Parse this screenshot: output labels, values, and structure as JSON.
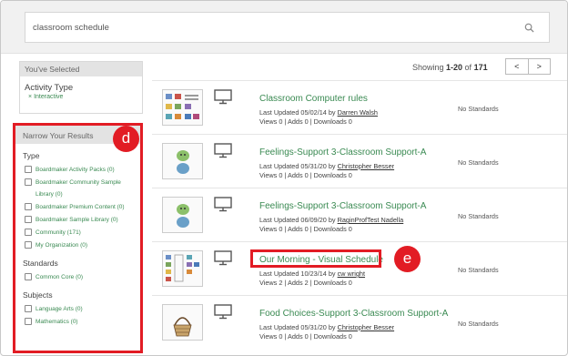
{
  "search": {
    "value": "classroom schedule"
  },
  "selected": {
    "header": "You've Selected",
    "filter_title": "Activity Type",
    "filter_remove": "×",
    "filter_value": "Interactive"
  },
  "narrow": {
    "header": "Narrow Your Results",
    "type_label": "Type",
    "type_options": [
      {
        "label": "Boardmaker Activity Packs (0)"
      },
      {
        "label": "Boardmaker Community Sample",
        "cont": "Library (0)"
      },
      {
        "label": "Boardmaker Premium Content (0)"
      },
      {
        "label": "Boardmaker Sample Library (0)"
      },
      {
        "label": "Community (171)"
      },
      {
        "label": "My Organization (0)"
      }
    ],
    "standards_label": "Standards",
    "standards_options": [
      {
        "label": "Common Core (0)"
      }
    ],
    "subjects_label": "Subjects",
    "subjects_options": [
      {
        "label": "Language Arts (0)"
      },
      {
        "label": "Mathematics (0)"
      }
    ]
  },
  "results": {
    "showing_prefix": "Showing ",
    "showing_range": "1-20",
    "showing_of": " of ",
    "showing_total": "171",
    "prev": "<",
    "next": ">",
    "items": [
      {
        "title": "Classroom Computer rules",
        "updated": "Last Updated 05/02/14 by ",
        "author": "Darren Walsh",
        "stats": "Views 0 | Adds 0 | Downloads 0",
        "standards": "No Standards"
      },
      {
        "title": "Feelings-Support 3-Classroom Support-A",
        "updated": "Last Updated 05/31/20 by ",
        "author": "Christopher Besser",
        "stats": "Views 0 | Adds 0 | Downloads 0",
        "standards": "No Standards"
      },
      {
        "title": "Feelings-Support 3-Classroom Support-A",
        "updated": "Last Updated 06/09/20 by ",
        "author": "RaginProfTest Nadella",
        "stats": "Views 0 | Adds 0 | Downloads 0",
        "standards": "No Standards"
      },
      {
        "title": "Our Morning - Visual Schedule",
        "updated": "Last Updated 10/23/14 by ",
        "author": "cw wright",
        "stats": "Views 2 | Adds 2 | Downloads 0",
        "standards": "No Standards"
      },
      {
        "title": "Food Choices-Support 3-Classroom Support-A",
        "updated": "Last Updated 05/31/20 by ",
        "author": "Christopher Besser",
        "stats": "Views 0 | Adds 0 | Downloads 0",
        "standards": "No Standards"
      }
    ]
  },
  "annotations": {
    "d": "d",
    "e": "e"
  },
  "colors": {
    "accent_green": "#3a8a52",
    "highlight_red": "#e21c24"
  }
}
